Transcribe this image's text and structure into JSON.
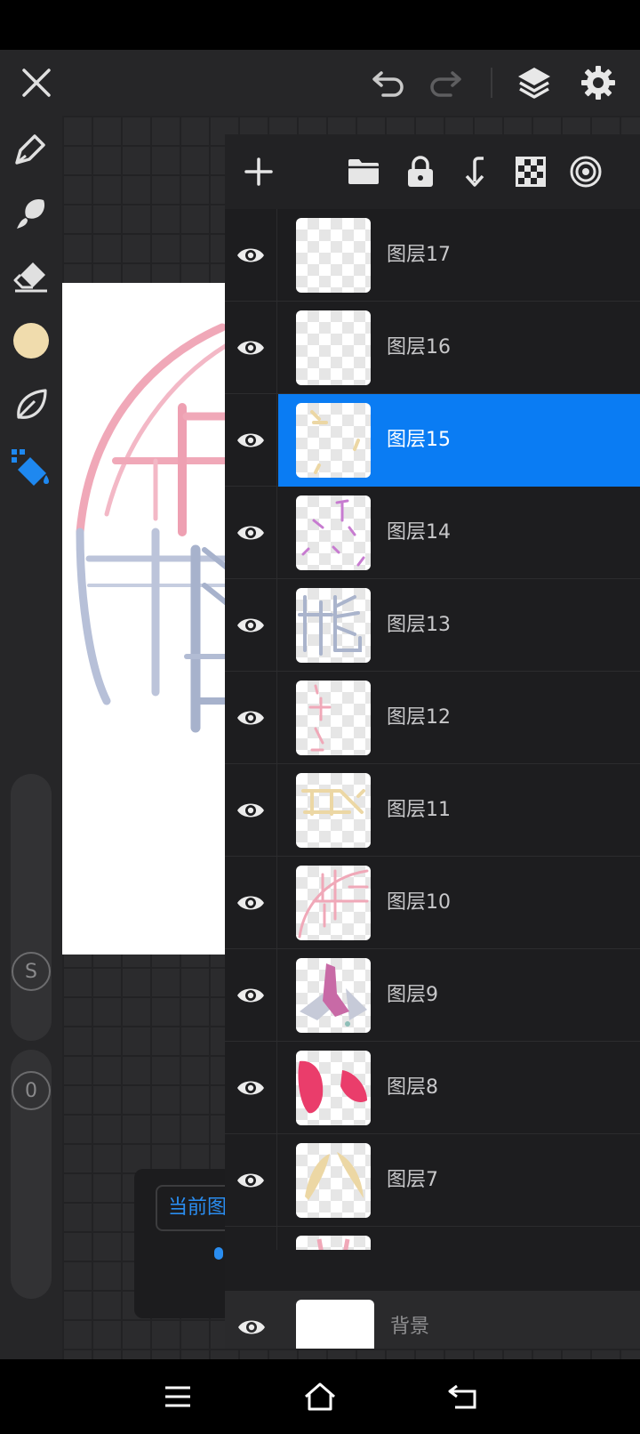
{
  "topbar": {
    "close_icon": "close-icon",
    "undo_icon": "undo-icon",
    "redo_icon": "redo-icon",
    "layers_icon": "layers-icon",
    "settings_icon": "gear-icon"
  },
  "tools": {
    "active_tool": "fill-bucket",
    "current_color": "#f0dcad",
    "accent_color": "#1e88f0",
    "size_slider_label": "S",
    "opacity_slider_label": "0"
  },
  "popup": {
    "field_text": "当前图"
  },
  "layer_panel": {
    "layers": [
      {
        "name": "图层17",
        "visible": true,
        "selected": false
      },
      {
        "name": "图层16",
        "visible": true,
        "selected": false
      },
      {
        "name": "图层15",
        "visible": true,
        "selected": true
      },
      {
        "name": "图层14",
        "visible": true,
        "selected": false
      },
      {
        "name": "图层13",
        "visible": true,
        "selected": false
      },
      {
        "name": "图层12",
        "visible": true,
        "selected": false
      },
      {
        "name": "图层11",
        "visible": true,
        "selected": false
      },
      {
        "name": "图层10",
        "visible": true,
        "selected": false
      },
      {
        "name": "图层9",
        "visible": true,
        "selected": false
      },
      {
        "name": "图层8",
        "visible": true,
        "selected": false
      },
      {
        "name": "图层7",
        "visible": true,
        "selected": false
      }
    ],
    "background_layer": {
      "name": "背景",
      "visible": true
    }
  }
}
